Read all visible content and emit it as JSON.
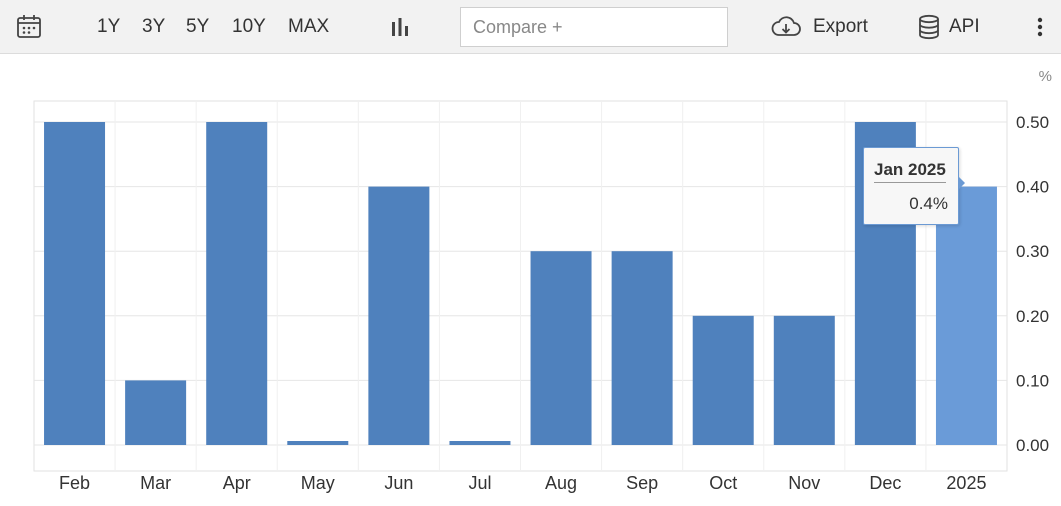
{
  "toolbar": {
    "ranges": [
      "1Y",
      "3Y",
      "5Y",
      "10Y",
      "MAX"
    ],
    "compare_placeholder": "Compare +",
    "export_label": "Export",
    "api_label": "API"
  },
  "tooltip": {
    "date": "Jan 2025",
    "value": "0.4%"
  },
  "colors": {
    "bar": "#4f81bd",
    "bar_highlight": "#6a9bd8",
    "grid": "#e6e6e6"
  },
  "chart_data": {
    "type": "bar",
    "unit": "%",
    "categories": [
      "Feb",
      "Mar",
      "Apr",
      "May",
      "Jun",
      "Jul",
      "Aug",
      "Sep",
      "Oct",
      "Nov",
      "Dec",
      "2025"
    ],
    "values": [
      0.5,
      0.1,
      0.5,
      0.0,
      0.4,
      0.0,
      0.3,
      0.3,
      0.2,
      0.2,
      0.5,
      0.4
    ],
    "y_ticks": [
      "0.00",
      "0.10",
      "0.20",
      "0.30",
      "0.40",
      "0.50"
    ],
    "ylim": [
      0,
      0.5
    ],
    "highlighted_index": 11,
    "grid": true
  }
}
